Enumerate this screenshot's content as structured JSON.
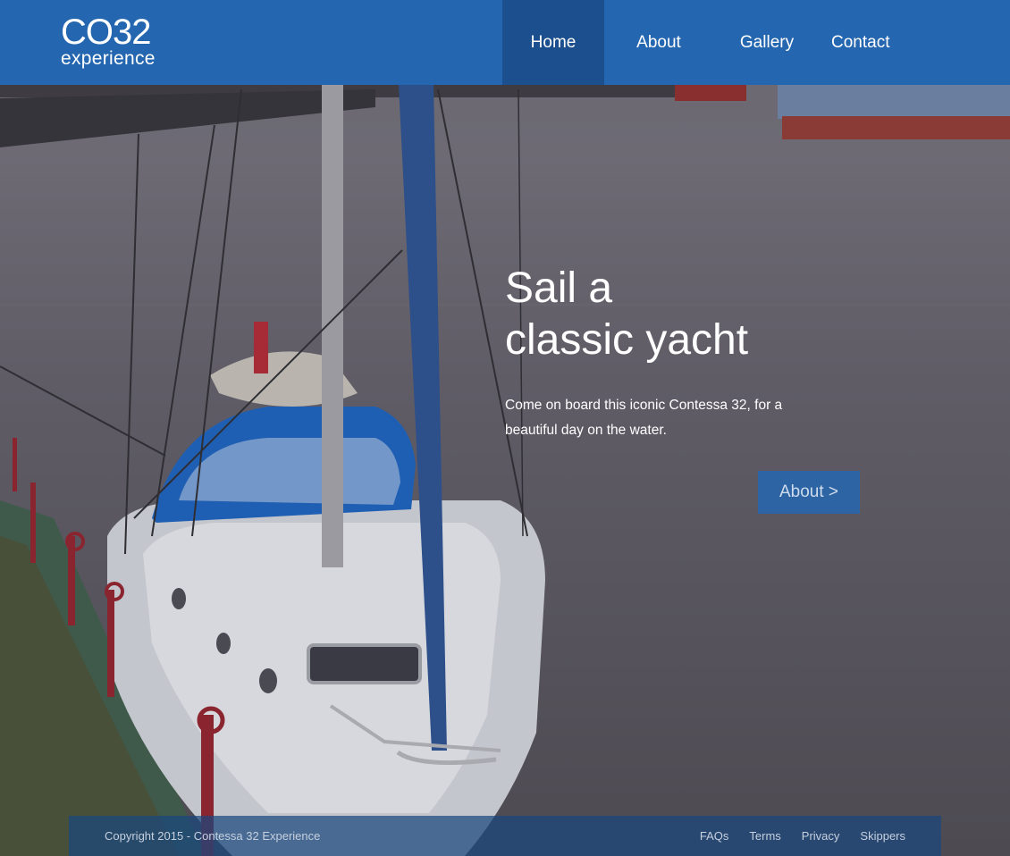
{
  "header": {
    "logo": {
      "mark": "CO32",
      "sub": "experience"
    },
    "nav": [
      {
        "label": "Home",
        "active": true
      },
      {
        "label": "About"
      },
      {
        "label": "Gallery"
      },
      {
        "label": "Contact"
      }
    ]
  },
  "hero": {
    "title_line1": "Sail a",
    "title_line2": "classic yacht",
    "text": "Come on board this iconic Contessa 32, for a beautiful day on the water.",
    "button_label": "About >"
  },
  "footer": {
    "copyright": "Copyright 2015 - Contessa 32 Experience",
    "links": [
      "FAQs",
      "Terms",
      "Privacy",
      "Skippers"
    ]
  },
  "colors": {
    "brand_blue": "#2466b0",
    "active_nav": "#1b4f8e",
    "boat_canopy": "#1f5fb3",
    "harbour_water": "#5f5c66"
  }
}
